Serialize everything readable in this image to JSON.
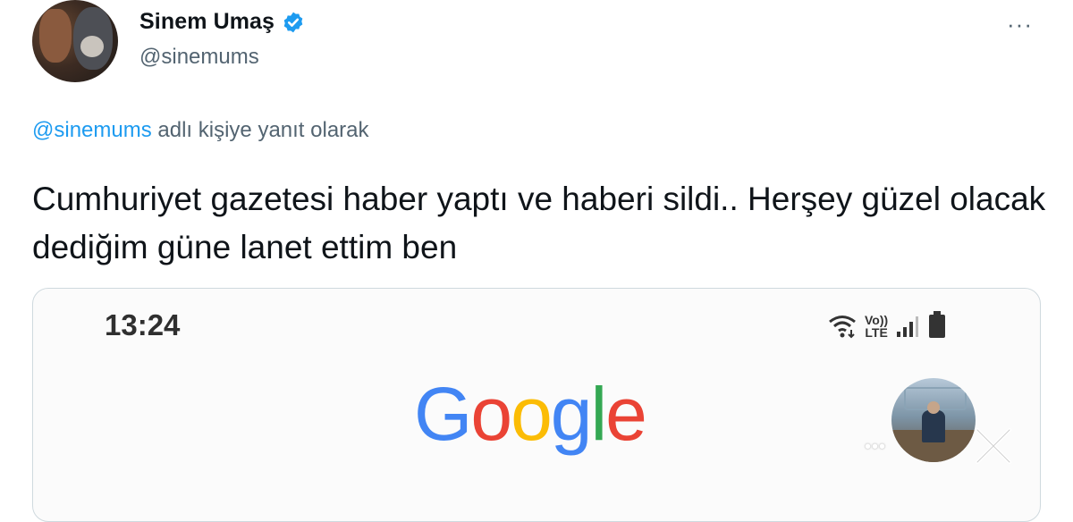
{
  "user": {
    "display_name": "Sinem Umaş",
    "handle": "@sinemums"
  },
  "reply": {
    "mention": "@sinemums",
    "suffix": " adlı kişiye yanıt olarak"
  },
  "tweet": {
    "text": "Cumhuriyet gazetesi haber yaptı ve haberi sildi.. Herşey güzel olacak dediğim güne lanet ettim ben"
  },
  "media": {
    "phone_time": "13:24",
    "lte_top": "Vo))",
    "lte_bottom": "LTE",
    "google_letters": [
      "G",
      "o",
      "o",
      "g",
      "l",
      "e"
    ],
    "more_dots": "•••"
  },
  "menu": {
    "more_label": "···"
  },
  "colors": {
    "verified": "#1d9bf0",
    "accent": "#1d9bf0",
    "secondary_text": "#536471"
  },
  "icons": {
    "verified": "verified-badge-icon",
    "more": "more-options-icon",
    "wifi": "wifi-icon",
    "signal": "signal-icon",
    "battery": "battery-icon",
    "close": "close-icon"
  }
}
